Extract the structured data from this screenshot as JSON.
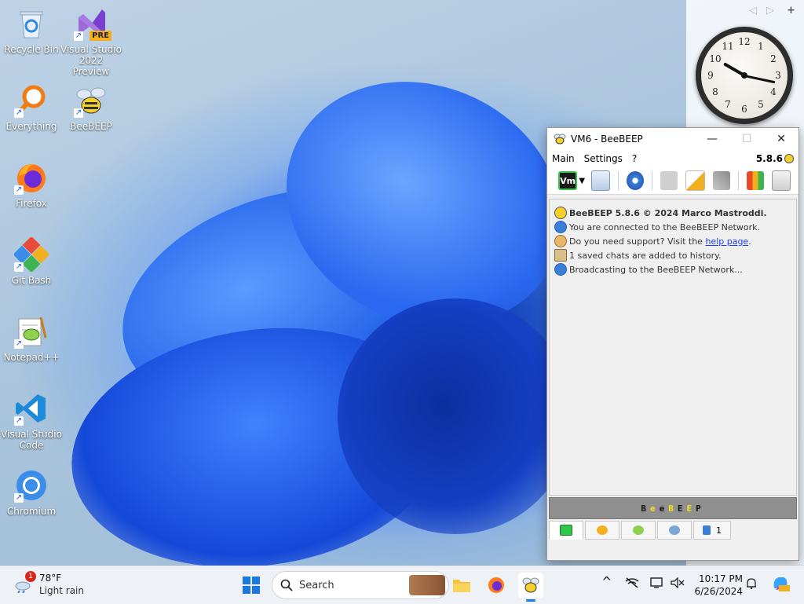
{
  "desktop": {
    "icons": [
      {
        "label": "Recycle Bin"
      },
      {
        "label": "Visual Studio 2022 Preview",
        "badge": "PRE"
      },
      {
        "label": "Everything"
      },
      {
        "label": "BeeBEEP"
      },
      {
        "label": "Firefox"
      },
      {
        "label": "Git Bash"
      },
      {
        "label": "Notepad++"
      },
      {
        "label": "Visual Studio Code"
      },
      {
        "label": "Chromium"
      }
    ]
  },
  "clock_gadget": {
    "numbers": [
      "12",
      "1",
      "2",
      "3",
      "4",
      "5",
      "6",
      "7",
      "8",
      "9",
      "10",
      "11"
    ],
    "nav": {
      "prev": "◁",
      "next": "▷",
      "add": "+"
    }
  },
  "beebeep": {
    "title": "VM6 - BeeBEEP",
    "controls": {
      "minimize": "—",
      "maximize": "☐",
      "close": "✕"
    },
    "menu": {
      "main": "Main",
      "settings": "Settings",
      "help": "?",
      "version": "5.8.6"
    },
    "toolbar": {
      "vm_label": "Vm"
    },
    "messages": {
      "line1": "BeeBEEP 5.8.6 © 2024 Marco Mastroddi.",
      "line2": "You are connected to the BeeBEEP Network.",
      "line3_prefix": "Do you need support? Visit the ",
      "line3_link": "help page",
      "line3_suffix": ".",
      "line4": "1 saved chats are added to history.",
      "line5": "Broadcasting to the BeeBEEP Network..."
    },
    "brand": {
      "b1": "B",
      "b2": "e",
      "b3": "e",
      "b4": "B",
      "b5": "E",
      "b6": "E",
      "b7": "P"
    },
    "tabs": {
      "last_count": "1"
    }
  },
  "taskbar": {
    "weather": {
      "temp": "78°F",
      "desc": "Light rain",
      "badge": "1"
    },
    "search_placeholder": "Search",
    "time": "10:17 PM",
    "date": "6/26/2024",
    "tray_chevron": "^"
  }
}
